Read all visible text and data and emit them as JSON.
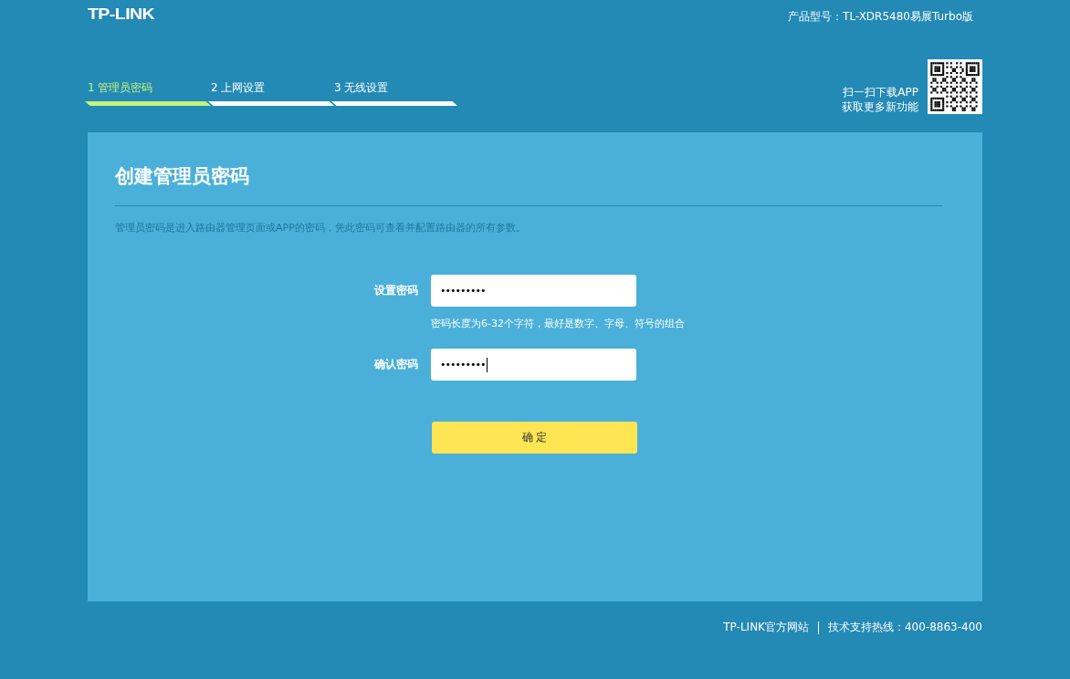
{
  "header": {
    "logo": "TP-LINK",
    "model": "产品型号：TL-XDR5480易展Turbo版"
  },
  "steps": [
    {
      "label": "1 管理员密码",
      "selected": true
    },
    {
      "label": "2 上网设置",
      "selected": false
    },
    {
      "label": "3 无线设置",
      "selected": false
    }
  ],
  "app_promo": {
    "lines": [
      "扫一扫下载APP",
      "获取更多新功能"
    ]
  },
  "panel": {
    "title": "创建管理员密码",
    "description": "管理员密码是进入路由器管理页面或APP的密码，凭此密码可查看并配置路由器的所有参数。",
    "fields": [
      {
        "label": "设置密码",
        "value": "•••••••••",
        "hint": "密码长度为6-32个字符，最好是数字、字母、符号的组合",
        "focused": false
      },
      {
        "label": "确认密码",
        "value": "•••••••••",
        "focused": true
      }
    ],
    "submit": "确 定"
  },
  "footer": {
    "links": [
      "TP-LINK官方网站",
      "技术支持热线：400-8863-400"
    ]
  }
}
